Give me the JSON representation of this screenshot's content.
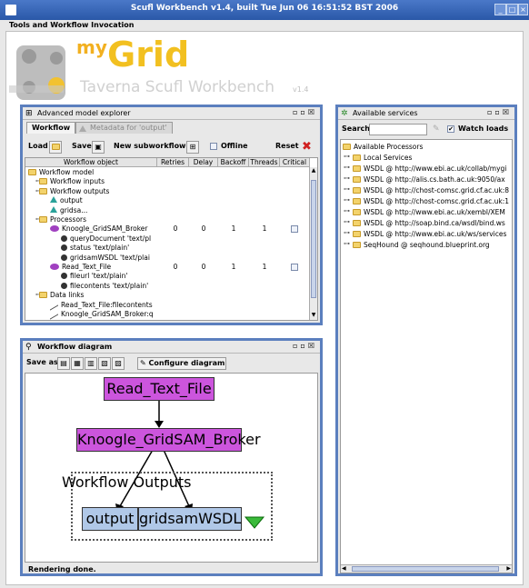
{
  "window": {
    "title": "Scufl Workbench v1.4, built Tue Jun 06 16:51:52 BST 2006",
    "menu": "Tools and Workflow Invocation"
  },
  "banner": {
    "my": "my",
    "grid": "Grid",
    "subtitle": "Taverna Scufl Workbench",
    "version": "v1.4"
  },
  "explorer": {
    "title": "Advanced model explorer",
    "tabs": [
      "Workflow",
      "Metadata for 'output'"
    ],
    "toolbar": {
      "load": "Load",
      "save": "Save",
      "new_sub": "New subworkflow",
      "offline": "Offline",
      "reset": "Reset"
    },
    "columns": [
      "Workflow object",
      "Retries",
      "Delay",
      "Backoff",
      "Threads",
      "Critical"
    ],
    "rows": [
      {
        "label": "Workflow model",
        "kind": "folder",
        "indent": 0
      },
      {
        "label": "Workflow inputs",
        "kind": "folder",
        "indent": 1
      },
      {
        "label": "Workflow outputs",
        "kind": "folder",
        "indent": 1
      },
      {
        "label": "output",
        "kind": "tri",
        "indent": 2
      },
      {
        "label": "gridsa...",
        "kind": "tri",
        "indent": 2
      },
      {
        "label": "Processors",
        "kind": "folder",
        "indent": 1
      },
      {
        "label": "Knoogle_GridSAM_Broker",
        "kind": "proc",
        "indent": 2,
        "retries": "0",
        "delay": "0",
        "backoff": "1",
        "threads": "1",
        "critical": true
      },
      {
        "label": "queryDocument 'text/pl",
        "kind": "port",
        "indent": 3
      },
      {
        "label": "status 'text/plain'",
        "kind": "port",
        "indent": 3
      },
      {
        "label": "gridsamWSDL 'text/plai",
        "kind": "port",
        "indent": 3
      },
      {
        "label": "Read_Text_File",
        "kind": "proc",
        "indent": 2,
        "retries": "0",
        "delay": "0",
        "backoff": "1",
        "threads": "1",
        "critical": true
      },
      {
        "label": "fileurl 'text/plain'",
        "kind": "port",
        "indent": 3
      },
      {
        "label": "filecontents 'text/plain'",
        "kind": "port",
        "indent": 3
      },
      {
        "label": "Data links",
        "kind": "folder",
        "indent": 1
      },
      {
        "label": "Read_Text_File:filecontents",
        "kind": "link",
        "indent": 2
      },
      {
        "label": "Knoogle_GridSAM_Broker:q",
        "kind": "link",
        "indent": 2
      }
    ]
  },
  "diagram": {
    "title": "Workflow diagram",
    "save_as": "Save as",
    "configure": "Configure diagram",
    "nodes": {
      "read": "Read_Text_File",
      "broker": "Knoogle_GridSAM_Broker",
      "cluster": "Workflow Outputs",
      "output": "output",
      "gridsam": "gridsamWSDL"
    },
    "status": "Rendering done."
  },
  "services": {
    "title": "Available services",
    "search_label": "Search",
    "search_value": "",
    "watch_loads": "Watch loads",
    "items": [
      {
        "label": "Available Processors",
        "indent": 0
      },
      {
        "label": "Local Services",
        "indent": 1
      },
      {
        "label": "WSDL @ http://www.ebi.ac.uk/collab/mygi",
        "indent": 1
      },
      {
        "label": "WSDL @ http://alis.cs.bath.ac.uk:9050/ax",
        "indent": 1
      },
      {
        "label": "WSDL @ http://chost-comsc.grid.cf.ac.uk:8",
        "indent": 1
      },
      {
        "label": "WSDL @ http://chost-comsc.grid.cf.ac.uk:1",
        "indent": 1
      },
      {
        "label": "WSDL @ http://www.ebi.ac.uk/xembl/XEM",
        "indent": 1
      },
      {
        "label": "WSDL @ http://soap.bind.ca/wsdl/bind.ws",
        "indent": 1
      },
      {
        "label": "WSDL @ http://www.ebi.ac.uk/ws/services",
        "indent": 1
      },
      {
        "label": "SeqHound @ seqhound.blueprint.org",
        "indent": 1
      }
    ]
  }
}
